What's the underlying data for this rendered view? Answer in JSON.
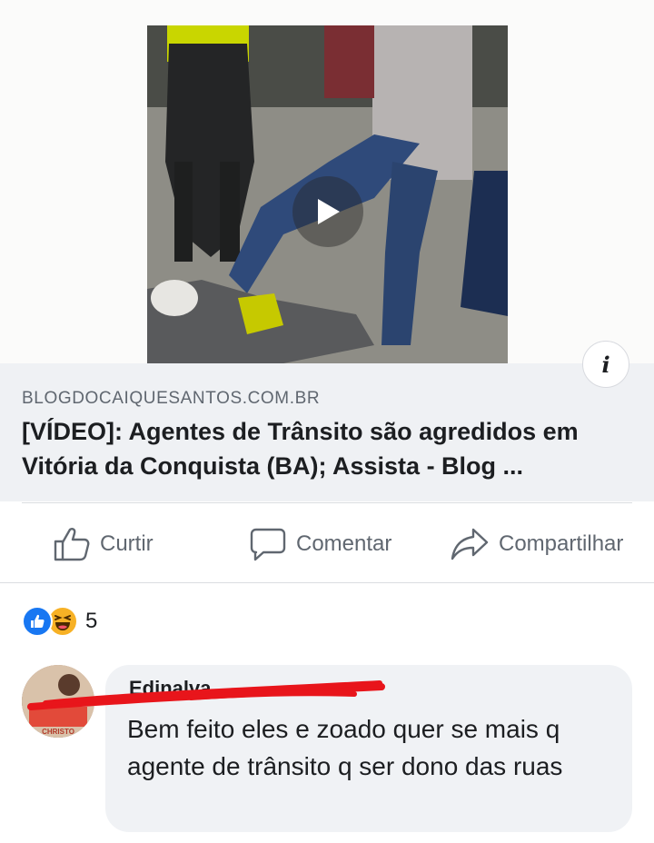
{
  "link_preview": {
    "domain": "BLOGDOCAIQUESANTOS.COM.BR",
    "title": "[VÍDEO]: Agentes de Trânsito são agredidos em Vitória da Conquista (BA); Assista - Blog ..."
  },
  "info_button": {
    "label": "i"
  },
  "actions": {
    "like": "Curtir",
    "comment": "Comentar",
    "share": "Compartilhar"
  },
  "reactions": {
    "types": [
      "like",
      "haha"
    ],
    "count": "5"
  },
  "comment": {
    "author": "Edinalva",
    "text": "Bem feito eles e zoado quer se mais q agente de trânsito q ser dono das ruas",
    "avatar_text": "CHRISTO"
  },
  "colors": {
    "accent": "#1877f2",
    "haha": "#f7b125",
    "redaction": "#e8151b"
  }
}
